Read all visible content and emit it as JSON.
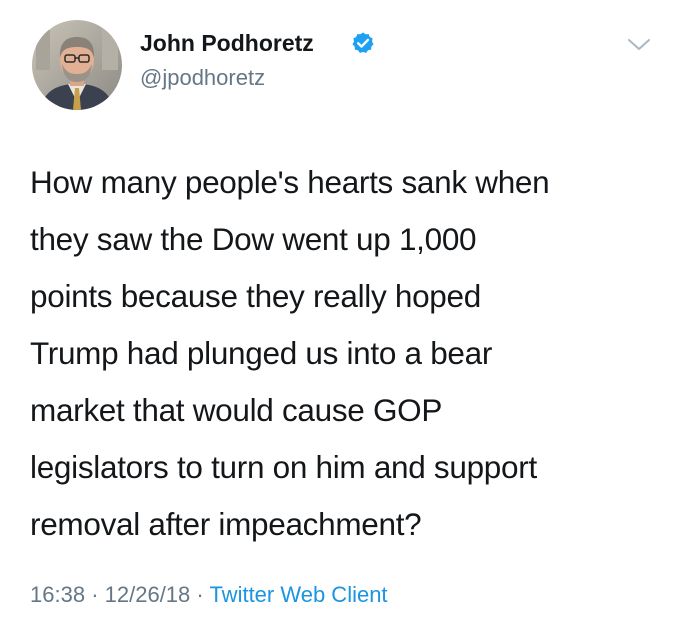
{
  "author": {
    "name": "John Podhoretz",
    "handle": "@jpodhoretz",
    "verified": true
  },
  "icons": {
    "verified": "verified-badge-icon",
    "menu": "chevron-down-icon"
  },
  "tweet": {
    "lines": [
      "How many people's hearts sank when",
      "they saw the Dow went up 1,000",
      "points because they really hoped",
      "Trump had plunged us into a bear",
      "market that would cause GOP",
      "legislators to turn on him and support",
      "removal after impeachment?"
    ]
  },
  "meta": {
    "time": "16:38",
    "separator": "·",
    "date": "12/26/18",
    "source": "Twitter Web Client"
  },
  "colors": {
    "text": "#14171a",
    "secondary": "#657786",
    "link": "#1b95e0",
    "verified": "#1da1f2"
  }
}
